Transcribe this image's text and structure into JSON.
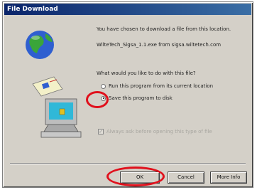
{
  "window": {
    "title": "File Download"
  },
  "message": {
    "line1": "You have chosen to download a file from this location.",
    "filename": "WilteTech_Sigsa_1.1.exe from sigsa.wiltetech.com",
    "question": "What would you like to do with this file?"
  },
  "options": [
    {
      "label": "Run this program from its current location",
      "selected": false
    },
    {
      "label": "Save this program to disk",
      "selected": true
    }
  ],
  "checkbox": {
    "label": "Always ask before opening this type of file",
    "checked": true,
    "enabled": false
  },
  "buttons": {
    "ok": "OK",
    "cancel": "Cancel",
    "more_info": "More Info"
  },
  "annotations": {
    "color": "#e0101c"
  },
  "icons": [
    "globe-icon",
    "document-icon",
    "computer-icon"
  ]
}
